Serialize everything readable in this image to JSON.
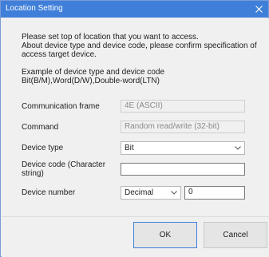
{
  "window": {
    "title": "Location Setting"
  },
  "intro": {
    "line1": "Please set top of location that you want to access.",
    "line2": "About device type and device code, please confirm specification of",
    "line3": "access target device."
  },
  "example": {
    "line1": "Example of device type and device code",
    "line2": "Bit(B/M),Word(D/W),Double-word(LTN)"
  },
  "form": {
    "communication_frame": {
      "label": "Communication frame",
      "value": "4E (ASCII)"
    },
    "command": {
      "label": "Command",
      "value": "Random read/write (32-bit)"
    },
    "device_type": {
      "label": "Device type",
      "value": "Bit"
    },
    "device_code": {
      "label_line1": "Device code (Character",
      "label_line2": "string)",
      "value": ""
    },
    "device_number": {
      "label": "Device number",
      "format": "Decimal",
      "value": "0"
    }
  },
  "buttons": {
    "ok": "OK",
    "cancel": "Cancel"
  },
  "colors": {
    "titlebar": "#3f7fd9",
    "dialog_bg": "#f0f0f0"
  }
}
